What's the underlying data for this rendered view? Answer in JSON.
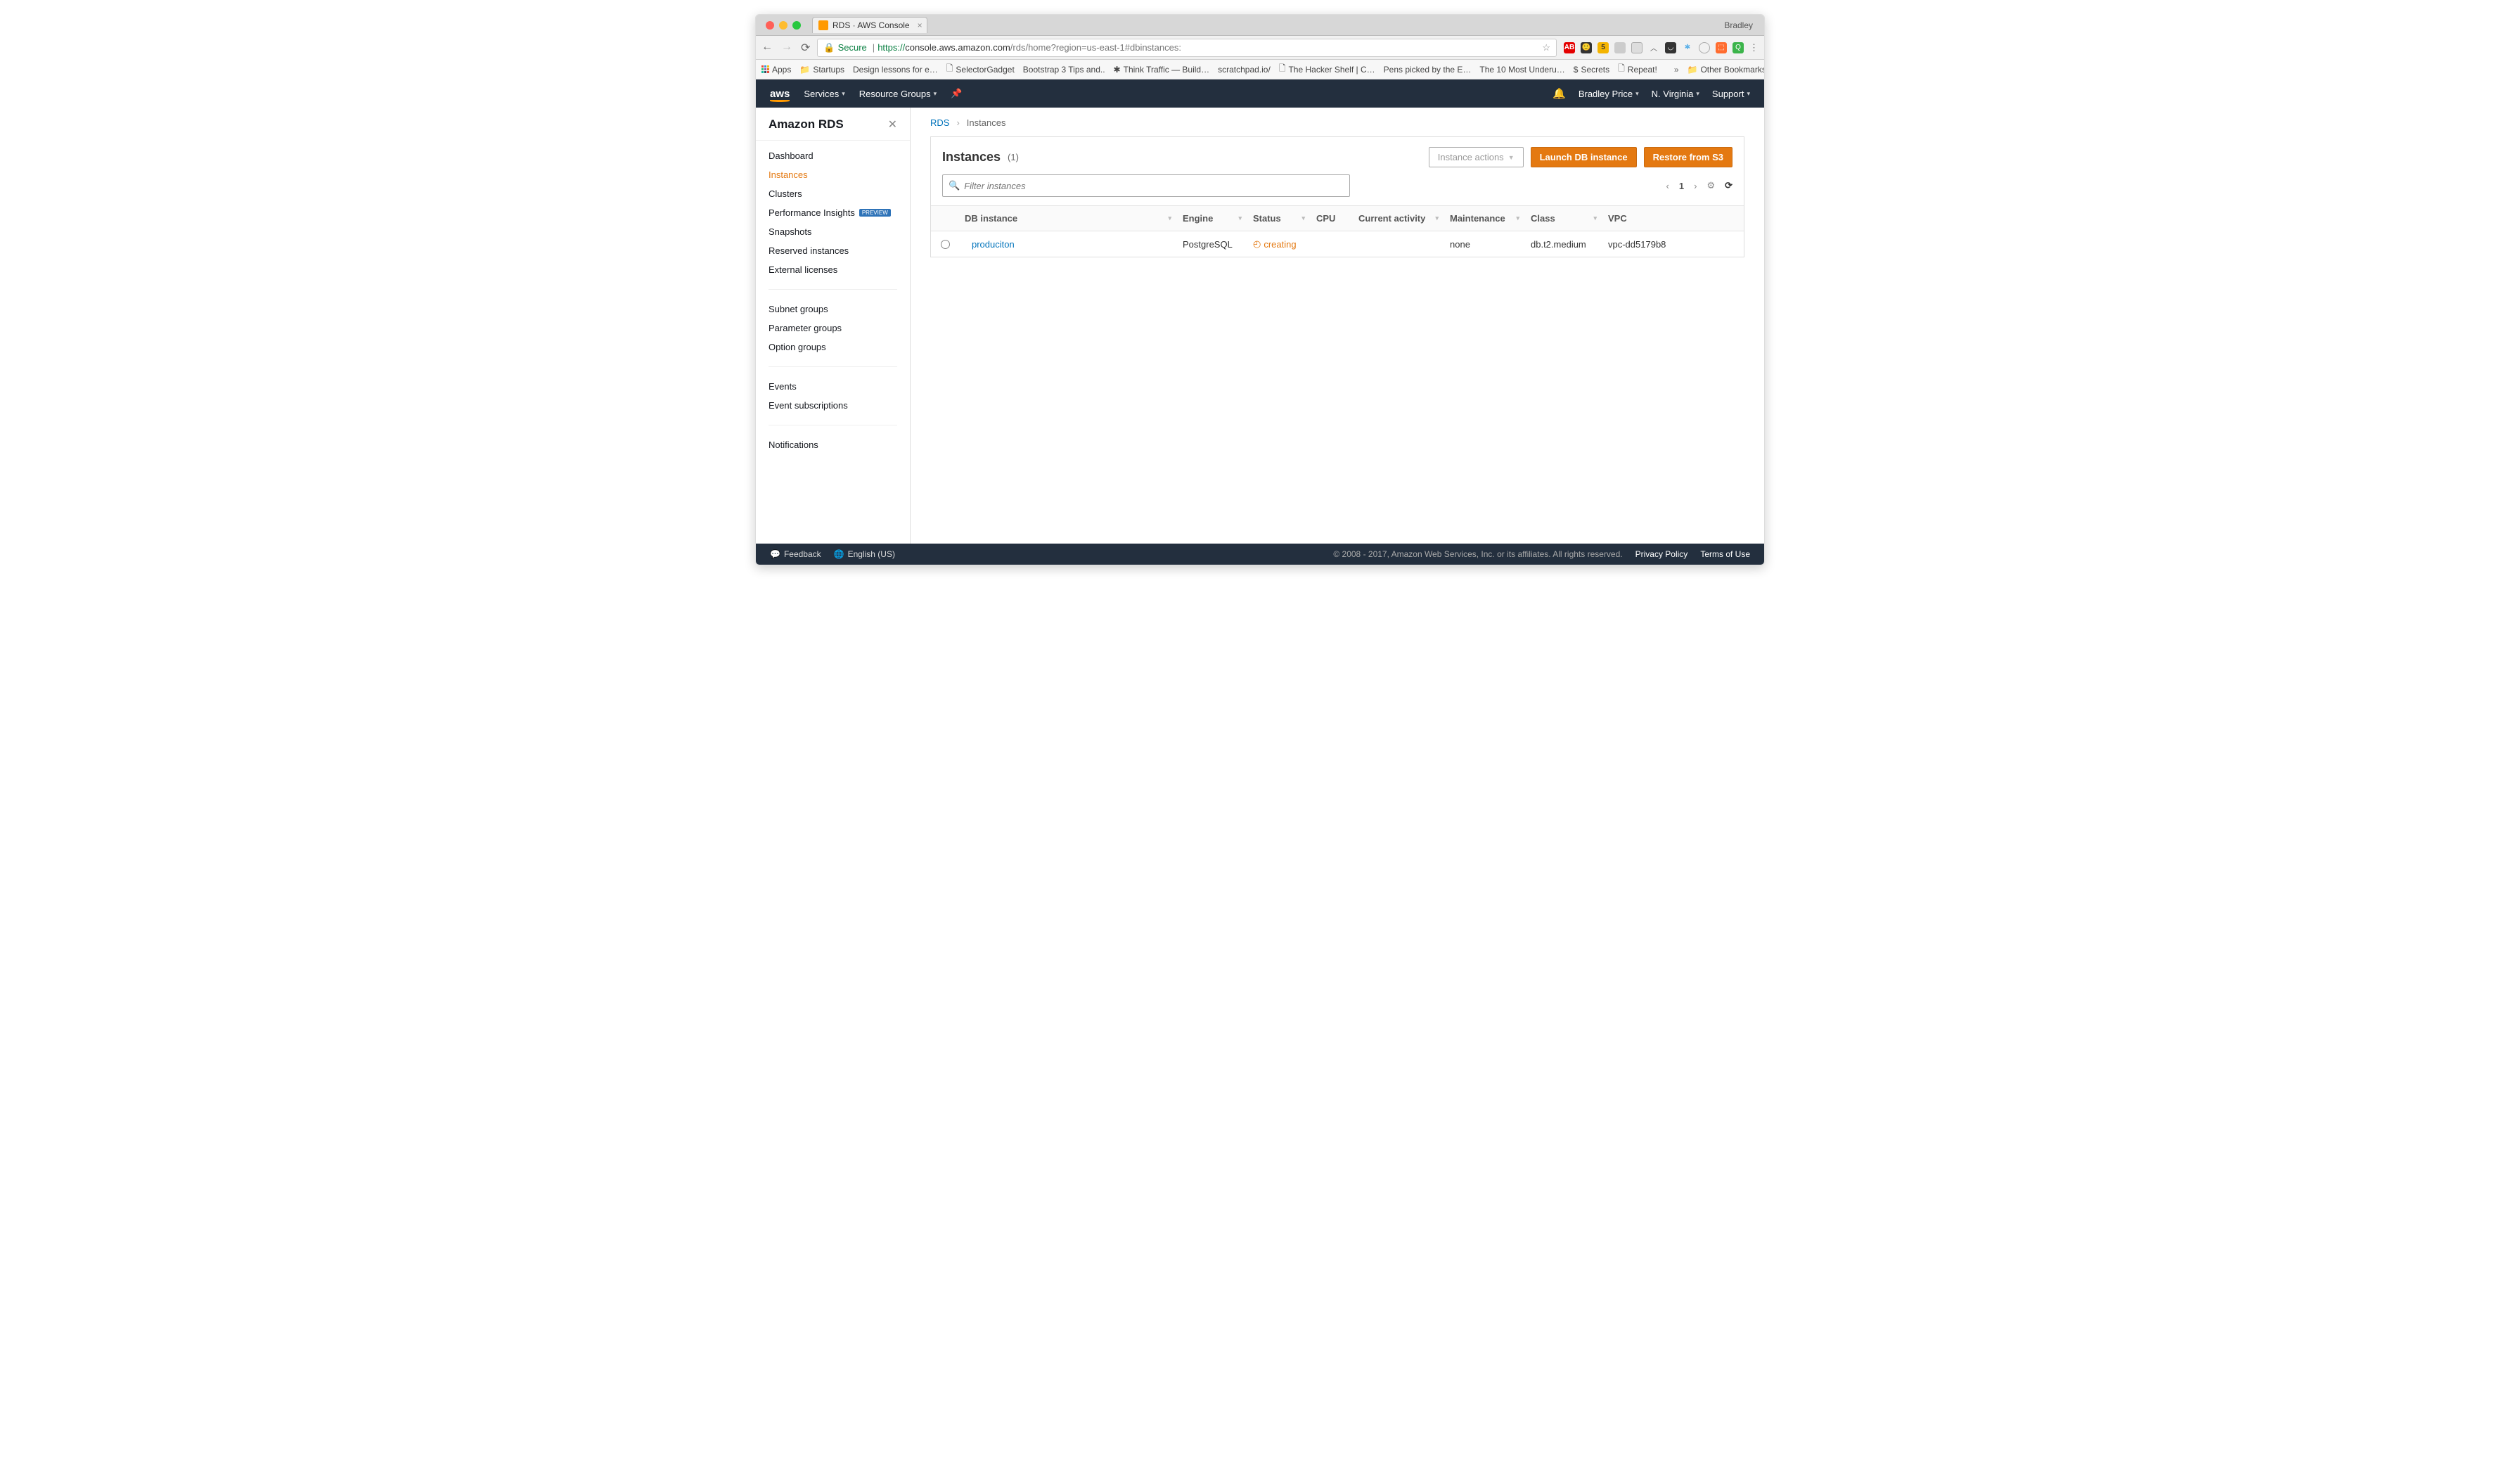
{
  "browser": {
    "tab_title": "RDS · AWS Console",
    "profile": "Bradley",
    "secure_label": "Secure",
    "url_proto": "https://",
    "url_host": "console.aws.amazon.com",
    "url_path": "/rds/home?region=us-east-1#dbinstances:",
    "bookmarks": [
      "Apps",
      "Startups",
      "Design lessons for e…",
      "SelectorGadget",
      "Bootstrap 3 Tips and..",
      "Think Traffic — Build…",
      "scratchpad.io/",
      "The Hacker Shelf | C…",
      "Pens picked by the E…",
      "The 10 Most Underu…",
      "Secrets",
      "Repeat!"
    ],
    "other_bookmarks": "Other Bookmarks"
  },
  "nav": {
    "services": "Services",
    "resource_groups": "Resource Groups",
    "user": "Bradley Price",
    "region": "N. Virginia",
    "support": "Support"
  },
  "sidebar": {
    "title": "Amazon RDS",
    "groups": [
      [
        "Dashboard",
        "Instances",
        "Clusters",
        "Performance Insights",
        "Snapshots",
        "Reserved instances",
        "External licenses"
      ],
      [
        "Subnet groups",
        "Parameter groups",
        "Option groups"
      ],
      [
        "Events",
        "Event subscriptions"
      ],
      [
        "Notifications"
      ]
    ],
    "active": "Instances",
    "preview_badge": "PREVIEW",
    "preview_on": "Performance Insights"
  },
  "breadcrumb": {
    "root": "RDS",
    "current": "Instances"
  },
  "panel": {
    "title": "Instances",
    "count": "(1)",
    "actions_btn": "Instance actions",
    "launch_btn": "Launch DB instance",
    "restore_btn": "Restore from S3",
    "filter_placeholder": "Filter instances",
    "page": "1"
  },
  "table": {
    "headers": {
      "db": "DB instance",
      "engine": "Engine",
      "status": "Status",
      "cpu": "CPU",
      "activity": "Current activity",
      "maint": "Maintenance",
      "class": "Class",
      "vpc": "VPC"
    },
    "rows": [
      {
        "db": "produciton",
        "engine": "PostgreSQL",
        "status": "creating",
        "cpu": "",
        "activity": "",
        "maint": "none",
        "class": "db.t2.medium",
        "vpc": "vpc-dd5179b8"
      }
    ]
  },
  "footer": {
    "feedback": "Feedback",
    "language": "English (US)",
    "copyright": "© 2008 - 2017, Amazon Web Services, Inc. or its affiliates. All rights reserved.",
    "privacy": "Privacy Policy",
    "terms": "Terms of Use"
  }
}
